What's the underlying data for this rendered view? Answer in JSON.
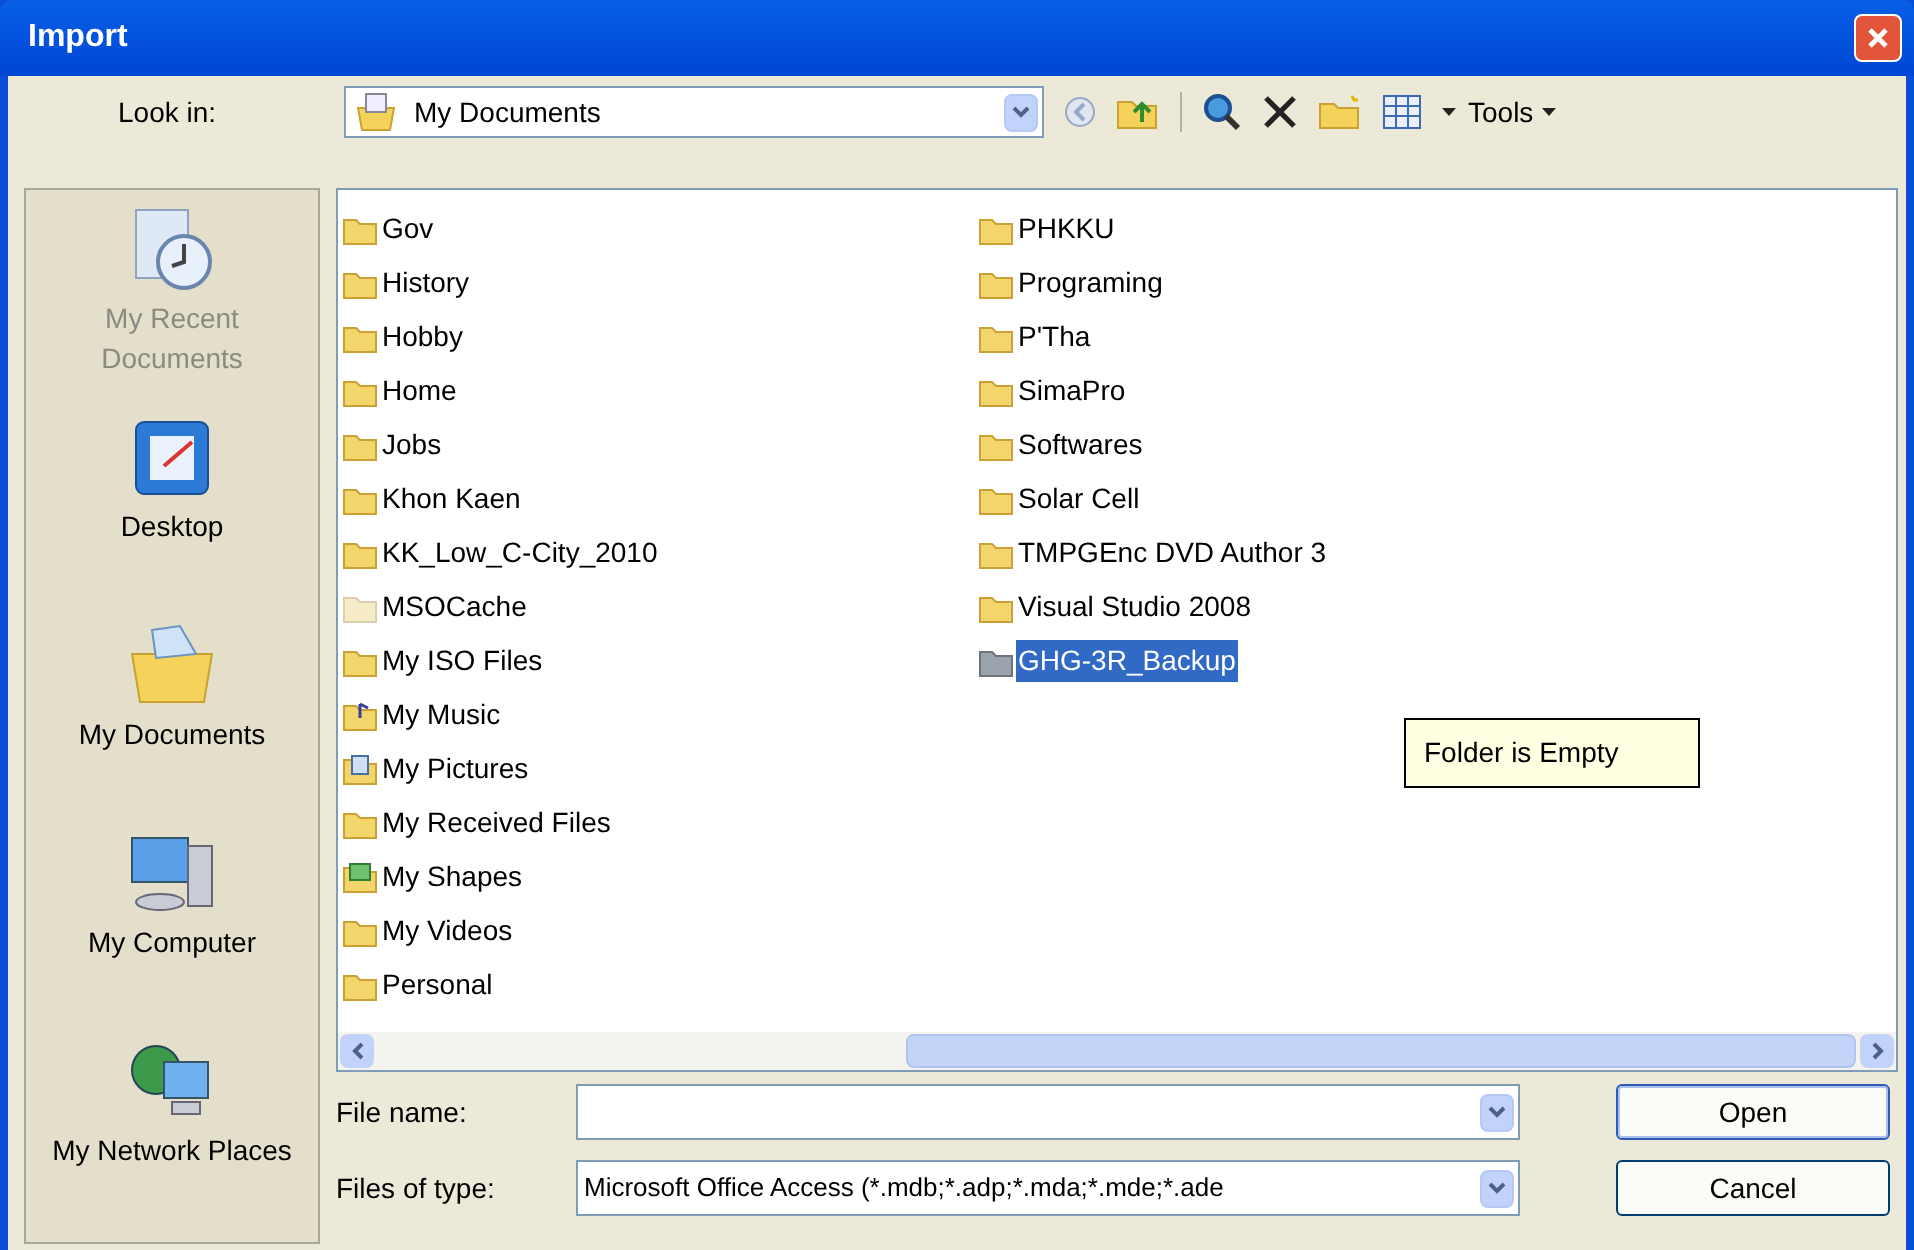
{
  "window": {
    "title": "Import"
  },
  "toolbar": {
    "look_in_label": "Look in:",
    "look_in_value": "My Documents",
    "tools_label": "Tools"
  },
  "places": [
    {
      "label": "My Recent Documents",
      "kind": "recent",
      "disabled": true
    },
    {
      "label": "Desktop",
      "kind": "desktop",
      "disabled": false
    },
    {
      "label": "My Documents",
      "kind": "documents",
      "disabled": false
    },
    {
      "label": "My Computer",
      "kind": "computer",
      "disabled": false
    },
    {
      "label": "My Network Places",
      "kind": "network",
      "disabled": false
    }
  ],
  "file_list": {
    "columns": [
      [
        {
          "name": "Gov",
          "kind": "folder",
          "selected": false
        },
        {
          "name": "History",
          "kind": "folder",
          "selected": false
        },
        {
          "name": "Hobby",
          "kind": "folder",
          "selected": false
        },
        {
          "name": "Home",
          "kind": "folder",
          "selected": false
        },
        {
          "name": "Jobs",
          "kind": "folder",
          "selected": false
        },
        {
          "name": "Khon Kaen",
          "kind": "folder",
          "selected": false
        },
        {
          "name": "KK_Low_C-City_2010",
          "kind": "folder",
          "selected": false
        },
        {
          "name": "MSOCache",
          "kind": "hidden",
          "selected": false
        },
        {
          "name": "My ISO Files",
          "kind": "folder",
          "selected": false
        },
        {
          "name": "My Music",
          "kind": "music",
          "selected": false
        },
        {
          "name": "My Pictures",
          "kind": "pictures",
          "selected": false
        },
        {
          "name": "My Received Files",
          "kind": "folder",
          "selected": false
        },
        {
          "name": "My Shapes",
          "kind": "shapes",
          "selected": false
        },
        {
          "name": "My Videos",
          "kind": "folder",
          "selected": false
        },
        {
          "name": "Personal",
          "kind": "folder",
          "selected": false
        }
      ],
      [
        {
          "name": "PHKKU",
          "kind": "folder",
          "selected": false
        },
        {
          "name": "Programing",
          "kind": "folder",
          "selected": false
        },
        {
          "name": "P'Tha",
          "kind": "folder",
          "selected": false
        },
        {
          "name": "SimaPro",
          "kind": "folder",
          "selected": false
        },
        {
          "name": "Softwares",
          "kind": "folder",
          "selected": false
        },
        {
          "name": "Solar Cell",
          "kind": "folder",
          "selected": false
        },
        {
          "name": "TMPGEnc DVD Author 3",
          "kind": "folder",
          "selected": false
        },
        {
          "name": "Visual Studio 2008",
          "kind": "folder",
          "selected": false
        },
        {
          "name": "GHG-3R_Backup",
          "kind": "folder",
          "selected": true
        }
      ]
    ],
    "tooltip": "Folder is Empty"
  },
  "file_name": {
    "label": "File name:"
  },
  "file_type": {
    "label": "Files of type:",
    "value": "Microsoft Office Access (*.mdb;*.adp;*.mda;*.mde;*.ade"
  },
  "buttons": [
    "Open",
    "Cancel"
  ]
}
